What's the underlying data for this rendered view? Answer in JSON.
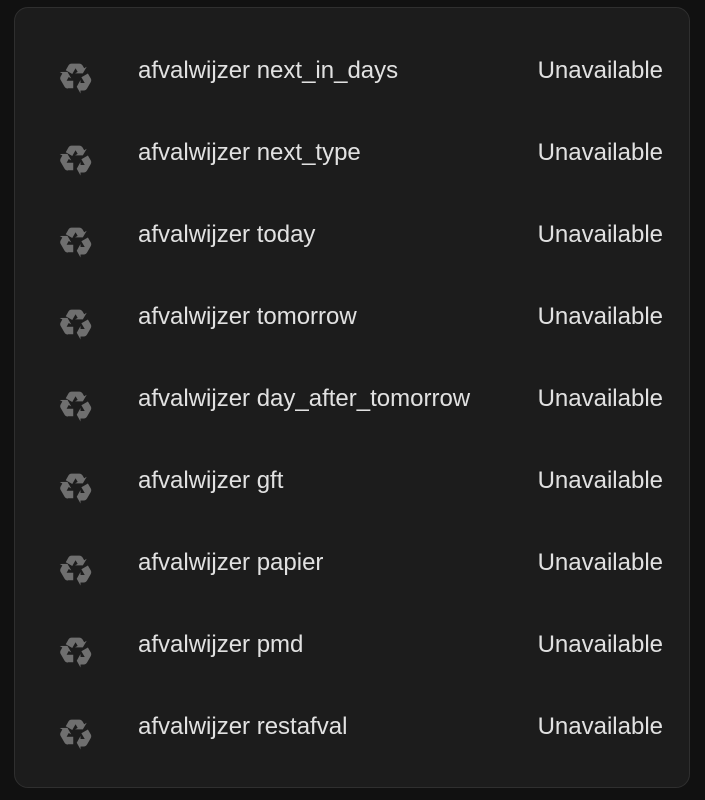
{
  "entities": [
    {
      "name": "afvalwijzer next_in_days",
      "state": "Unavailable",
      "icon": "recycle-icon"
    },
    {
      "name": "afvalwijzer next_type",
      "state": "Unavailable",
      "icon": "recycle-icon"
    },
    {
      "name": "afvalwijzer today",
      "state": "Unavailable",
      "icon": "recycle-icon"
    },
    {
      "name": "afvalwijzer tomorrow",
      "state": "Unavailable",
      "icon": "recycle-icon"
    },
    {
      "name": "afvalwijzer day_after_tomorrow",
      "state": "Unavailable",
      "icon": "recycle-icon"
    },
    {
      "name": "afvalwijzer gft",
      "state": "Unavailable",
      "icon": "recycle-icon"
    },
    {
      "name": "afvalwijzer papier",
      "state": "Unavailable",
      "icon": "recycle-icon"
    },
    {
      "name": "afvalwijzer pmd",
      "state": "Unavailable",
      "icon": "recycle-icon"
    },
    {
      "name": "afvalwijzer restafval",
      "state": "Unavailable",
      "icon": "recycle-icon"
    }
  ],
  "colors": {
    "background": "#111111",
    "card": "#1c1c1c",
    "text": "#e1e1e1",
    "icon": "#6f6f6f"
  }
}
